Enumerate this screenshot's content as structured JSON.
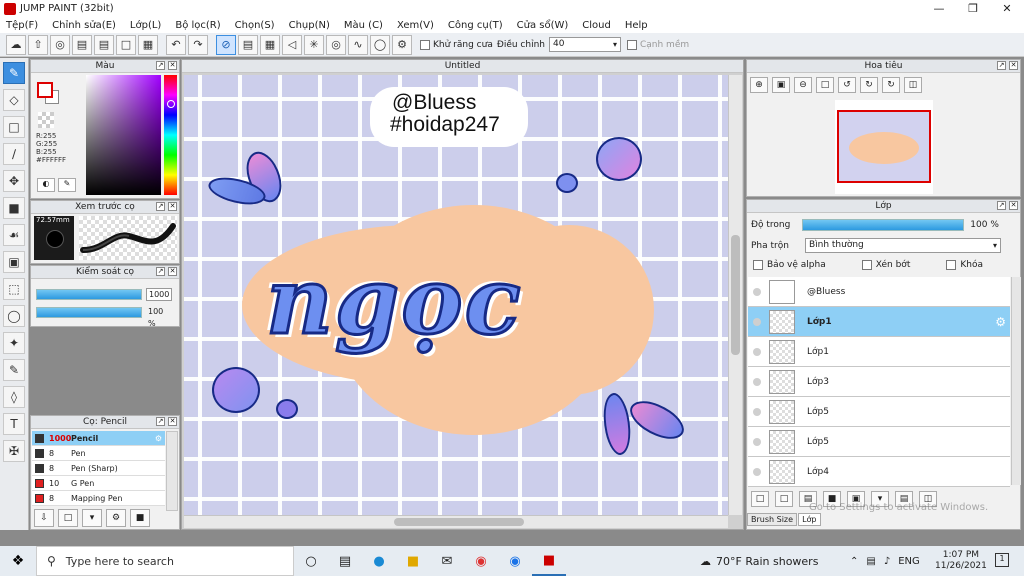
{
  "window": {
    "title": "JUMP PAINT (32bit)"
  },
  "menu": [
    "Tệp(F)",
    "Chỉnh sửa(E)",
    "Lớp(L)",
    "Bộ lọc(R)",
    "Chọn(S)",
    "Chụp(N)",
    "Màu (C)",
    "Xem(V)",
    "Công cụ(T)",
    "Cửa sổ(W)",
    "Cloud",
    "Help"
  ],
  "toolbar": {
    "antialias_label": "Khử răng cưa",
    "adjust_label": "Điều chỉnh",
    "adjust_value": "40",
    "snap_label": "Cạnh mềm"
  },
  "color_panel": {
    "title": "Màu",
    "r": "R:255",
    "g": "G:255",
    "b": "B:255",
    "hex": "#FFFFFF"
  },
  "brush_preview": {
    "title": "Xem trước cọ",
    "size": "72.57mm"
  },
  "brush_control": {
    "title": "Kiểm soát cọ",
    "size_value": "1000",
    "opacity_value": "100 %"
  },
  "brush_panel": {
    "title": "Cọ: Pencil",
    "items": [
      {
        "size": "1000",
        "name": "Pencil",
        "color": "#333333",
        "selected": true
      },
      {
        "size": "8",
        "name": "Pen",
        "color": "#333333"
      },
      {
        "size": "8",
        "name": "Pen (Sharp)",
        "color": "#333333"
      },
      {
        "size": "10",
        "name": "G Pen",
        "color": "#e02020"
      },
      {
        "size": "8",
        "name": "Mapping Pen",
        "color": "#e02020"
      }
    ]
  },
  "canvas": {
    "title": "Untitled",
    "watermark_line1": "@Bluess",
    "watermark_line2": "#hoidap247",
    "artwork_text": "ngọc"
  },
  "navigator": {
    "title": "Hoa tiêu"
  },
  "layers_panel": {
    "title": "Lớp",
    "opacity_label": "Độ trong",
    "opacity_value": "100 %",
    "blend_label": "Pha trộn",
    "blend_value": "Bình thường",
    "protect_alpha": "Bảo vệ alpha",
    "clip": "Xén bớt",
    "lock": "Khóa",
    "layers": [
      "@Bluess",
      "Lớp1",
      "Lớp1",
      "Lớp3",
      "Lớp5",
      "Lớp5",
      "Lớp4"
    ],
    "tab_brush_size": "Brush Size",
    "tab_layer": "Lớp",
    "activate_text": "Go to Settings to activate Windows."
  },
  "taskbar": {
    "search_placeholder": "Type here to search",
    "weather": "70°F  Rain showers",
    "language": "ENG",
    "time": "1:07 PM",
    "date": "11/26/2021",
    "notification_count": "1"
  }
}
